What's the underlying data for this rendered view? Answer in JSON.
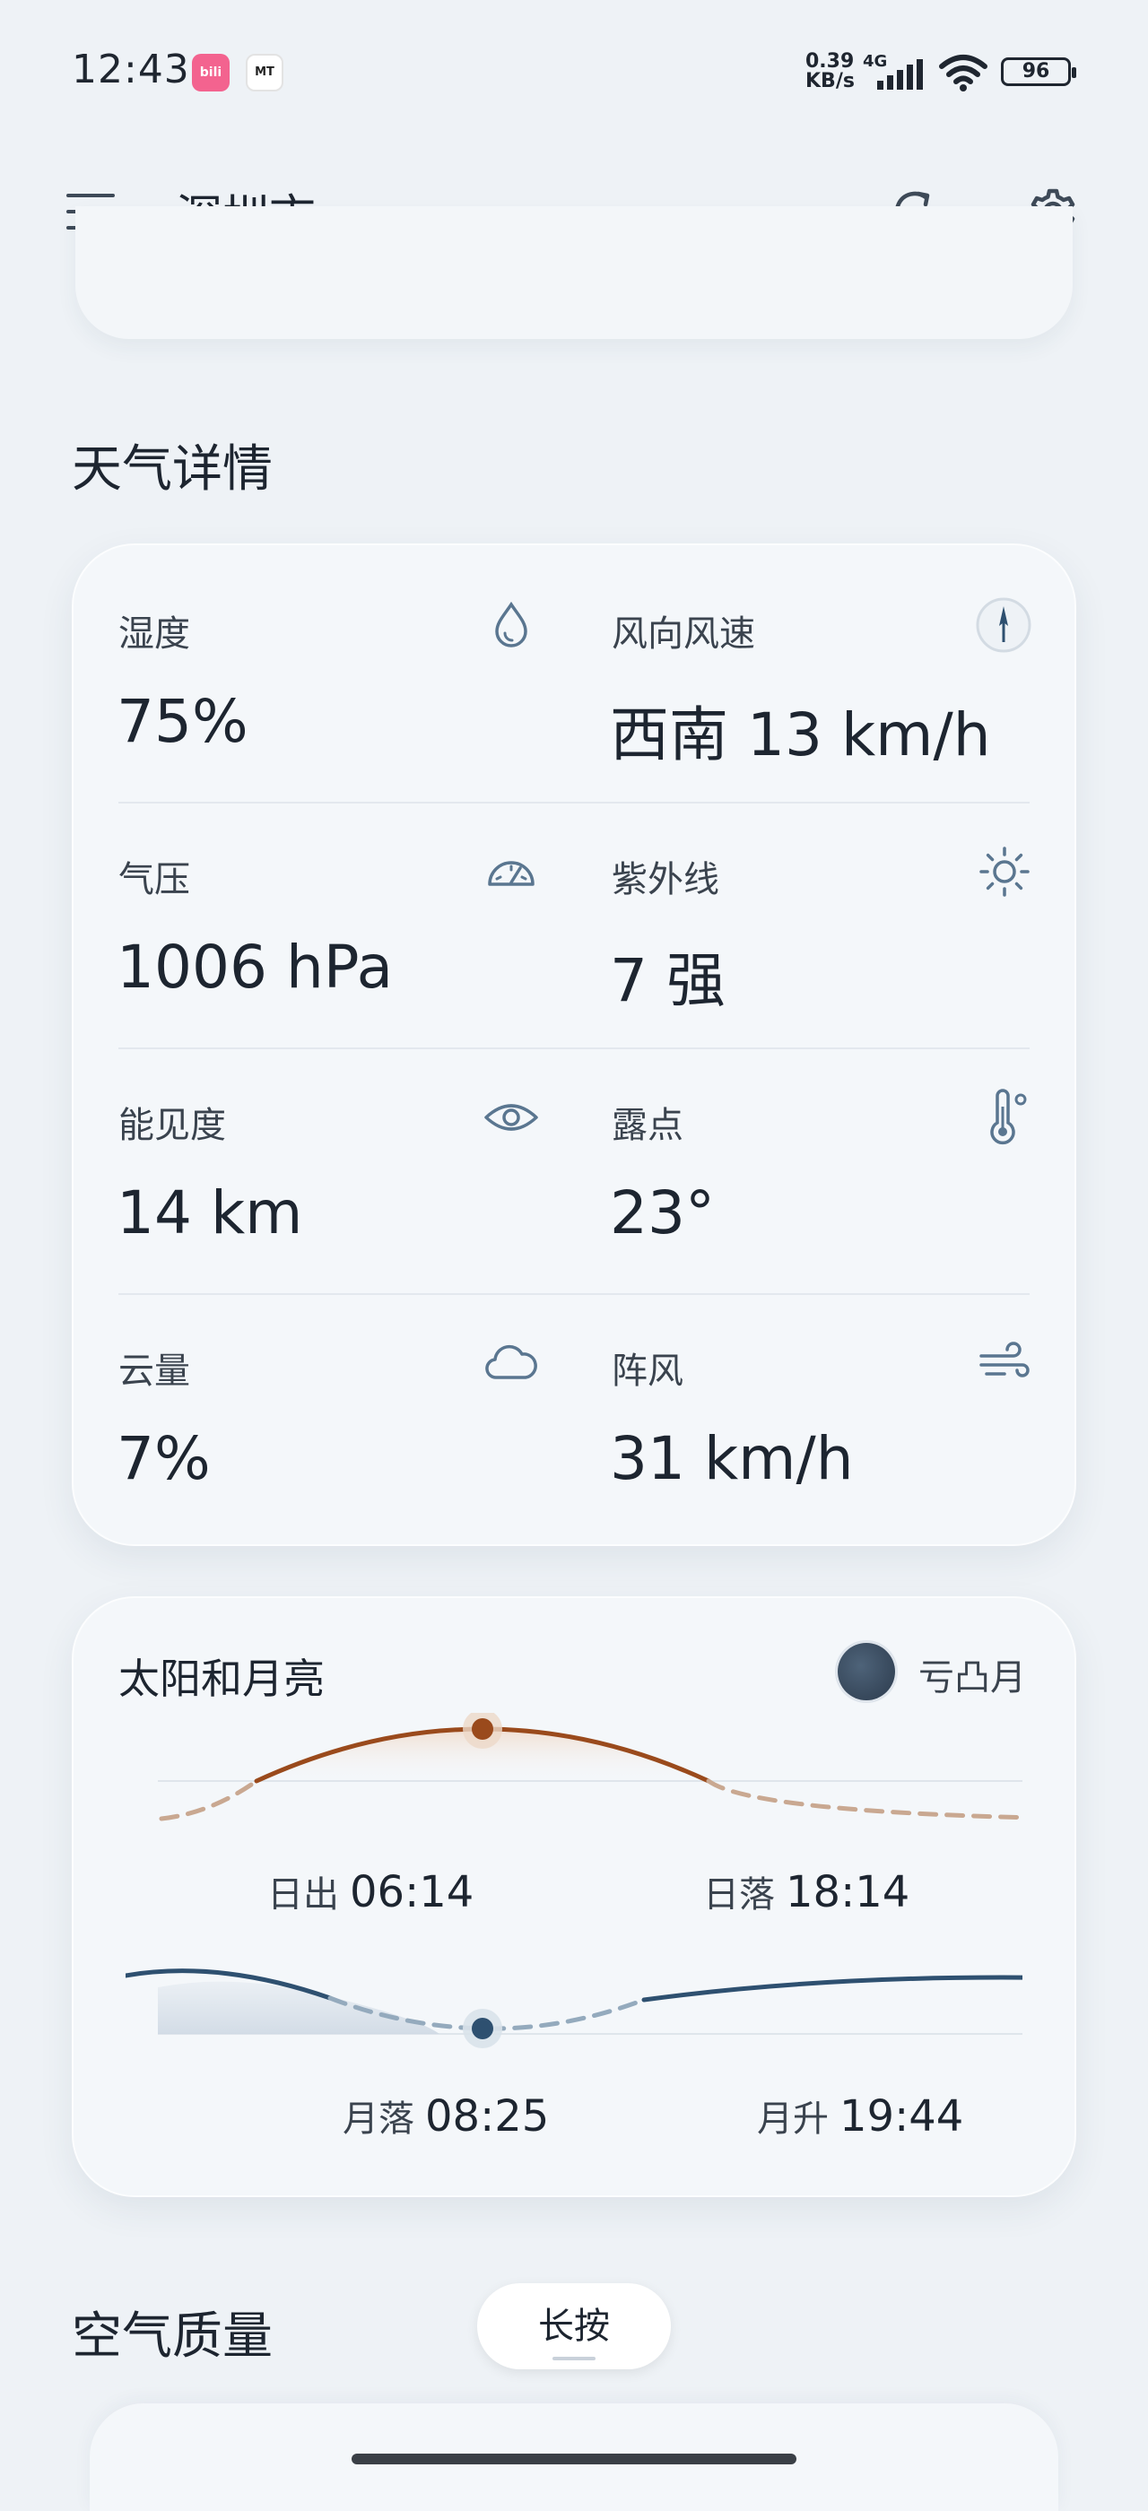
{
  "status_bar": {
    "time": "12:43",
    "app1": "bili",
    "app2": "MT",
    "net_speed_value": "0.39",
    "net_speed_unit": "KB/s",
    "network": "4G",
    "battery": "96"
  },
  "app_bar": {
    "title": "深圳市",
    "menu_icon": "menu-icon",
    "refresh_icon": "refresh-icon",
    "settings_icon": "gear-icon"
  },
  "weather_details": {
    "title": "天气详情",
    "items": [
      {
        "label": "湿度",
        "value": "75%",
        "icon": "droplet-icon"
      },
      {
        "label": "风向风速",
        "value": "西南 13 km/h",
        "icon": "compass-icon"
      },
      {
        "label": "气压",
        "value": "1006 hPa",
        "icon": "gauge-icon"
      },
      {
        "label": "紫外线",
        "value": "7 强",
        "icon": "sun-icon"
      },
      {
        "label": "能见度",
        "value": "14 km",
        "icon": "eye-icon"
      },
      {
        "label": "露点",
        "value": "23°",
        "icon": "thermometer-icon"
      },
      {
        "label": "云量",
        "value": "7%",
        "icon": "cloud-icon"
      },
      {
        "label": "阵风",
        "value": "31 km/h",
        "icon": "wind-icon"
      }
    ]
  },
  "sun_moon": {
    "title": "太阳和月亮",
    "moon_phase": "亏凸月",
    "sunrise_label": "日出",
    "sunrise_time": "06:14",
    "sunset_label": "日落",
    "sunset_time": "18:14",
    "moonset_label": "月落",
    "moonset_time": "08:25",
    "moonrise_label": "月升",
    "moonrise_time": "19:44",
    "colors": {
      "sun": "#9a4a1c",
      "moon": "#2e5070"
    }
  },
  "air_quality": {
    "title": "空气质量",
    "hint": "长按"
  }
}
